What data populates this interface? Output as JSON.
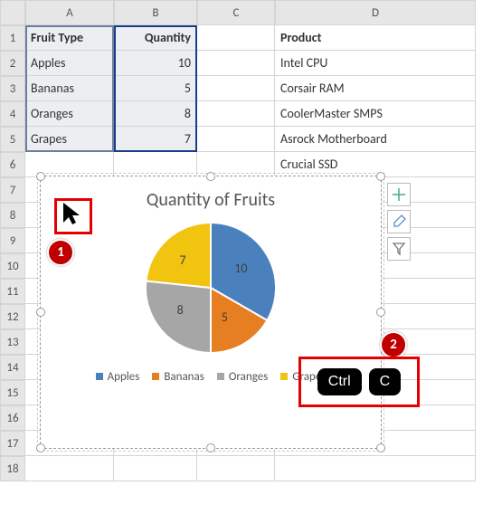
{
  "cols": [
    "A",
    "B",
    "C",
    "D"
  ],
  "rows": [
    "1",
    "2",
    "3",
    "4",
    "5",
    "6",
    "7",
    "8",
    "9",
    "10",
    "11",
    "12",
    "13",
    "14",
    "15",
    "16",
    "17",
    "18"
  ],
  "table": {
    "A": [
      "Fruit Type",
      "Apples",
      "Bananas",
      "Oranges",
      "Grapes"
    ],
    "B": [
      "Quantity",
      "10",
      "5",
      "8",
      "7"
    ],
    "D": [
      "Product",
      "Intel CPU",
      "Corsair RAM",
      "CoolerMaster SMPS",
      "Asrock Motherboard",
      "Crucial SSD"
    ]
  },
  "chart_data": {
    "type": "pie",
    "title": "Quantity of Fruits",
    "categories": [
      "Apples",
      "Bananas",
      "Oranges",
      "Grapes"
    ],
    "values": [
      10,
      5,
      8,
      7
    ],
    "colors": [
      "#4a81bd",
      "#e67e22",
      "#a6a6a6",
      "#f1c40f"
    ]
  },
  "side": {
    "plus": "+",
    "brush": "brush",
    "filter": "filter"
  },
  "ann": {
    "num1": "1",
    "num2": "2",
    "ctrl": "Ctrl",
    "c": "C"
  }
}
